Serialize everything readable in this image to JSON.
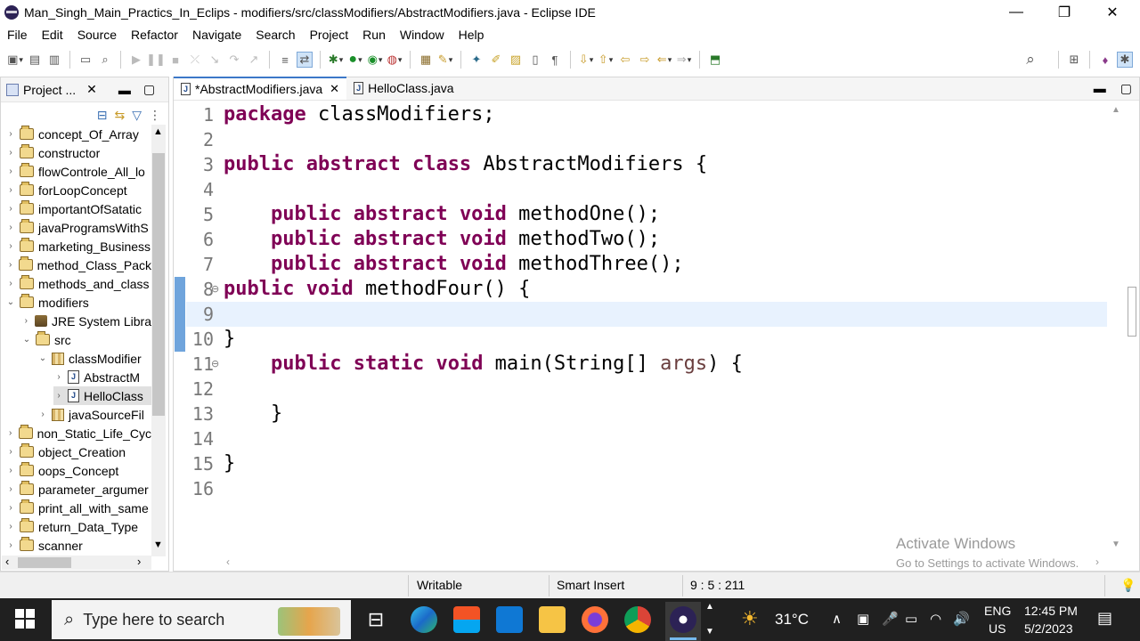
{
  "titlebar": {
    "title": "Man_Singh_Main_Practics_In_Eclips - modifiers/src/classModifiers/AbstractModifiers.java - Eclipse IDE",
    "minimize": "—",
    "maximize": "❐",
    "close": "✕"
  },
  "menubar": [
    "File",
    "Edit",
    "Source",
    "Refactor",
    "Navigate",
    "Search",
    "Project",
    "Run",
    "Window",
    "Help"
  ],
  "explorer": {
    "tab_label": "Project ...",
    "tab_close": "✕",
    "items": [
      {
        "label": "concept_Of_Array",
        "icon": "project-folder-icon",
        "twisty": "›"
      },
      {
        "label": "constructor",
        "icon": "project-folder-icon",
        "twisty": "›"
      },
      {
        "label": "flowControle_All_lo",
        "icon": "project-folder-icon",
        "twisty": "›"
      },
      {
        "label": "forLoopConcept",
        "icon": "project-folder-icon",
        "twisty": "›"
      },
      {
        "label": "importantOfSatatic",
        "icon": "project-folder-icon",
        "twisty": "›"
      },
      {
        "label": "javaProgramsWithS",
        "icon": "project-folder-icon",
        "twisty": "›"
      },
      {
        "label": "marketing_Business",
        "icon": "project-folder-icon",
        "twisty": "›"
      },
      {
        "label": "method_Class_Pack",
        "icon": "project-folder-icon",
        "twisty": "›"
      },
      {
        "label": "methods_and_class",
        "icon": "project-folder-icon",
        "twisty": "›"
      },
      {
        "label": "modifiers",
        "icon": "project-folder-icon",
        "twisty": "⌄"
      },
      {
        "label": "JRE System Libra",
        "icon": "library-icon",
        "twisty": "›"
      },
      {
        "label": "src",
        "icon": "source-folder-icon",
        "twisty": "⌄"
      },
      {
        "label": "classModifier",
        "icon": "package-icon",
        "twisty": "⌄"
      },
      {
        "label": "AbstractM",
        "icon": "java-file-icon",
        "twisty": "›"
      },
      {
        "label": "HelloClass",
        "icon": "java-file-icon",
        "twisty": "›"
      },
      {
        "label": "javaSourceFil",
        "icon": "package-icon",
        "twisty": "›"
      },
      {
        "label": "non_Static_Life_Cyc",
        "icon": "project-folder-icon",
        "twisty": "›"
      },
      {
        "label": "object_Creation",
        "icon": "project-folder-icon",
        "twisty": "›"
      },
      {
        "label": "oops_Concept",
        "icon": "project-folder-icon",
        "twisty": "›"
      },
      {
        "label": "parameter_argumer",
        "icon": "project-folder-icon",
        "twisty": "›"
      },
      {
        "label": "print_all_with_same",
        "icon": "project-folder-icon",
        "twisty": "›"
      },
      {
        "label": "return_Data_Type",
        "icon": "project-folder-icon",
        "twisty": "›"
      },
      {
        "label": "scanner",
        "icon": "project-folder-icon",
        "twisty": "›"
      }
    ]
  },
  "editor": {
    "tabs": [
      {
        "label": "*AbstractModifiers.java",
        "active": true
      },
      {
        "label": "HelloClass.java",
        "active": false
      }
    ],
    "line_numbers": [
      "1",
      "2",
      "3",
      "4",
      "5",
      "6",
      "7",
      "8",
      "9",
      "10",
      "11",
      "12",
      "13",
      "14",
      "15",
      "16"
    ],
    "lines": [
      [
        {
          "t": "package",
          "c": "kw"
        },
        {
          "t": " classModifiers;",
          "c": ""
        }
      ],
      [],
      [
        {
          "t": "public",
          "c": "kw"
        },
        {
          "t": " ",
          "c": ""
        },
        {
          "t": "abstract",
          "c": "kw"
        },
        {
          "t": " ",
          "c": ""
        },
        {
          "t": "class",
          "c": "kw"
        },
        {
          "t": " AbstractModifiers {",
          "c": ""
        }
      ],
      [],
      [
        {
          "t": "    ",
          "c": ""
        },
        {
          "t": "public",
          "c": "kw"
        },
        {
          "t": " ",
          "c": ""
        },
        {
          "t": "abstract",
          "c": "kw"
        },
        {
          "t": " ",
          "c": ""
        },
        {
          "t": "void",
          "c": "kw"
        },
        {
          "t": " methodOne();",
          "c": ""
        }
      ],
      [
        {
          "t": "    ",
          "c": ""
        },
        {
          "t": "public",
          "c": "kw"
        },
        {
          "t": " ",
          "c": ""
        },
        {
          "t": "abstract",
          "c": "kw"
        },
        {
          "t": " ",
          "c": ""
        },
        {
          "t": "void",
          "c": "kw"
        },
        {
          "t": " methodTwo();",
          "c": ""
        }
      ],
      [
        {
          "t": "    ",
          "c": ""
        },
        {
          "t": "public",
          "c": "kw"
        },
        {
          "t": " ",
          "c": ""
        },
        {
          "t": "abstract",
          "c": "kw"
        },
        {
          "t": " ",
          "c": ""
        },
        {
          "t": "void",
          "c": "kw"
        },
        {
          "t": " methodThree();",
          "c": ""
        }
      ],
      [
        {
          "t": "public",
          "c": "kw"
        },
        {
          "t": " ",
          "c": ""
        },
        {
          "t": "void",
          "c": "kw"
        },
        {
          "t": " methodFour() {",
          "c": ""
        }
      ],
      [],
      [
        {
          "t": "}",
          "c": ""
        }
      ],
      [
        {
          "t": "    ",
          "c": ""
        },
        {
          "t": "public",
          "c": "kw"
        },
        {
          "t": " ",
          "c": ""
        },
        {
          "t": "static",
          "c": "kw"
        },
        {
          "t": " ",
          "c": ""
        },
        {
          "t": "void",
          "c": "kw"
        },
        {
          "t": " main(String[] ",
          "c": ""
        },
        {
          "t": "args",
          "c": "param"
        },
        {
          "t": ") {",
          "c": ""
        }
      ],
      [],
      [
        {
          "t": "    }",
          "c": ""
        }
      ],
      [],
      [
        {
          "t": "}",
          "c": ""
        }
      ],
      []
    ]
  },
  "statusbar": {
    "writable": "Writable",
    "insert_mode": "Smart Insert",
    "position": "9 : 5 : 211"
  },
  "watermark": {
    "line1": "Activate Windows",
    "line2": "Go to Settings to activate Windows."
  },
  "taskbar": {
    "search_placeholder": "Type here to search",
    "weather": "31°C",
    "lang1": "ENG",
    "lang2": "US",
    "time": "12:45 PM",
    "date": "5/2/2023"
  },
  "colors": {
    "keyword": "#7f0055",
    "param": "#6a3e3e",
    "current_line": "#e8f2fe",
    "accent": "#3c78c8"
  }
}
